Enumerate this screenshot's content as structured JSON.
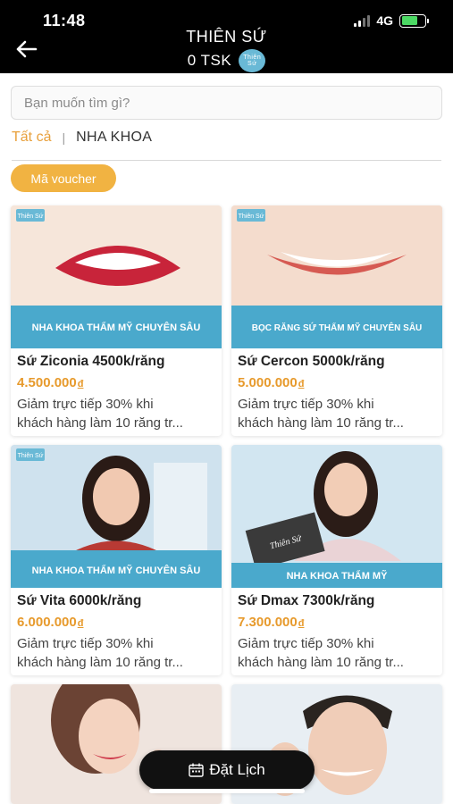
{
  "status_bar": {
    "time": "11:48",
    "network": "4G"
  },
  "header": {
    "title": "THIÊN SỨ",
    "balance": "0 TSK",
    "coin_label": "Thiên Sứ",
    "back_icon": "arrow-left-icon"
  },
  "search": {
    "placeholder": "Bạn muốn tìm gì?"
  },
  "breadcrumb": {
    "all": "Tất cả",
    "separator": "|",
    "current": "NHA KHOA"
  },
  "voucher_button": "Mã voucher",
  "products": [
    {
      "name": "Sứ Ziconia 4500k/răng",
      "price": "4.500.000",
      "currency": "đ",
      "desc_line1": "Giảm trực tiếp 30% khi",
      "desc_line2": "khách hàng làm 10 răng tr...",
      "banner": "NHA KHOA THẨM MỸ CHUYÊN SÂU",
      "brand": "Thiên Sứ"
    },
    {
      "name": "Sứ Cercon 5000k/răng",
      "price": "5.000.000",
      "currency": "đ",
      "desc_line1": "Giảm trực tiếp 30% khi",
      "desc_line2": "khách hàng làm 10 răng tr...",
      "banner": "BỌC RĂNG SỨ THẨM MỸ CHUYÊN SÂU",
      "brand": "Thiên Sứ"
    },
    {
      "name": "Sứ Vita 6000k/răng",
      "price": "6.000.000",
      "currency": "đ",
      "desc_line1": "Giảm trực tiếp 30% khi",
      "desc_line2": "khách hàng làm 10 răng tr...",
      "banner": "NHA KHOA THẨM MỸ CHUYÊN SÂU",
      "brand": "Thiên Sứ"
    },
    {
      "name": "Sứ Dmax 7300k/răng",
      "price": "7.300.000",
      "currency": "đ",
      "desc_line1": "Giảm trực tiếp 30% khi",
      "desc_line2": "khách hàng làm 10 răng tr...",
      "banner": "NHA KHOA THẨM MỸ",
      "brand": "Thiên Sứ"
    }
  ],
  "book_button": {
    "label": "Đặt Lịch",
    "icon": "calendar-icon"
  },
  "colors": {
    "accent": "#e8a03c",
    "voucher": "#f1b342",
    "banner": "#4aa9cc",
    "price": "#e79a2c"
  }
}
